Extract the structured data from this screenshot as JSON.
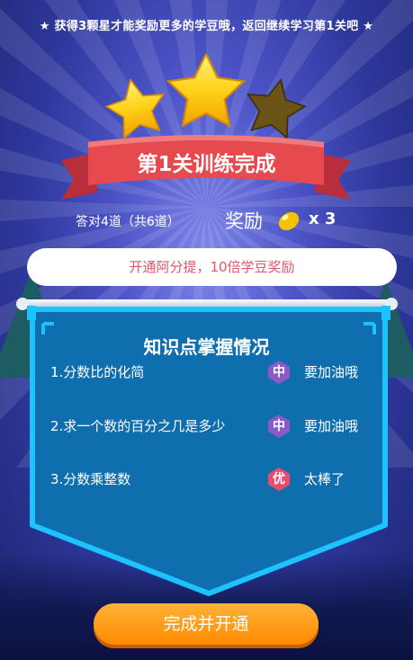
{
  "notice": "★ 获得3颗星才能奖励更多的学豆哦，返回继续学习第1关吧 ★",
  "stars": {
    "earned": 2,
    "total": 3
  },
  "result": {
    "title": "第1关训练完成",
    "answered": "答对4道（共6道）",
    "reward_label": "奖励",
    "reward_multiplier": "x 3"
  },
  "promo": {
    "label": "开通阿分提，10倍学豆奖励"
  },
  "knowledge": {
    "title": "知识点掌握情况",
    "items": [
      {
        "name": "1.分数比的化简",
        "badge": "中",
        "badge_color": "#8a5ac8",
        "comment": "要加油哦"
      },
      {
        "name": " 2.求一个数的百分之几是多少",
        "badge": "中",
        "badge_color": "#8a5ac8",
        "comment": "要加油哦"
      },
      {
        "name": "3.分数乘整数",
        "badge": "优",
        "badge_color": "#e94b6f",
        "comment": "太棒了"
      }
    ]
  },
  "cta": {
    "label": "完成并开通"
  },
  "colors": {
    "ribbon": "#e64a4f",
    "panel": "#0f6fae",
    "panel_border": "#1cc3ff",
    "cta": "#ff9a1a",
    "star_on": "#ffd21a",
    "star_off": "#6b5216"
  }
}
